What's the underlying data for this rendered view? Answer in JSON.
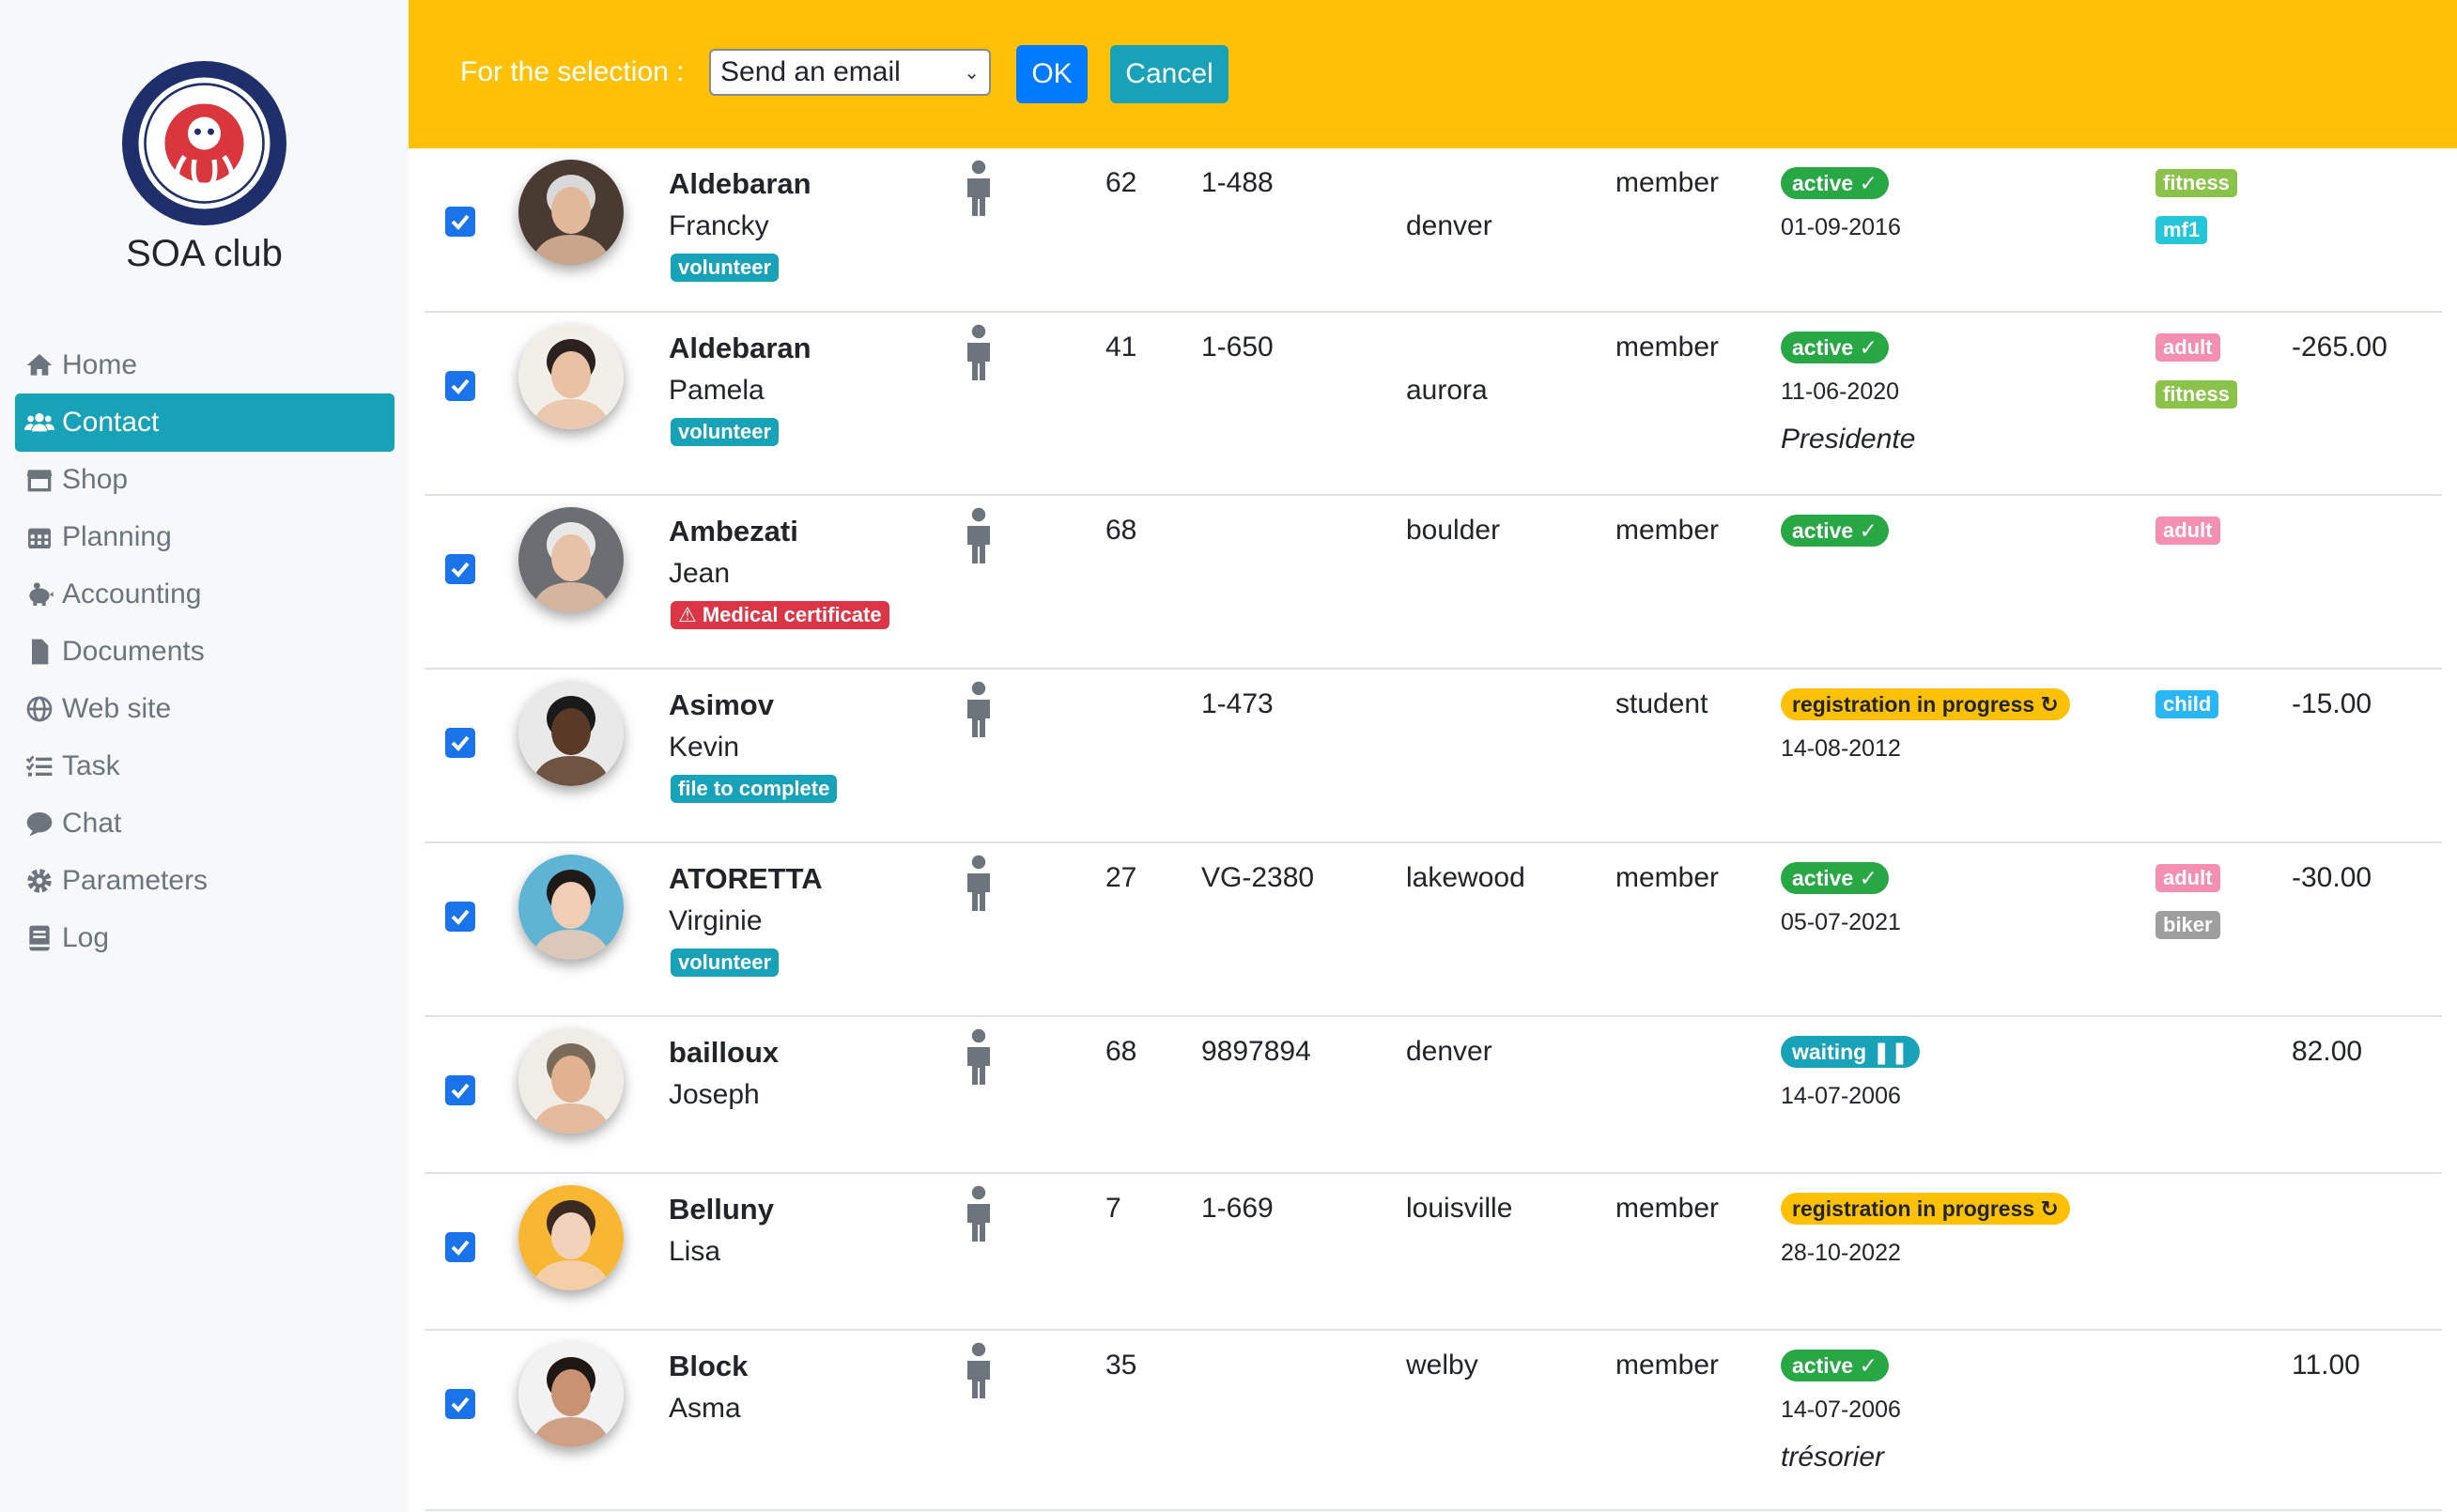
{
  "sidebar": {
    "club_name": "SOA club",
    "logo_icon": "dive-club-logo",
    "items": [
      {
        "label": "Home",
        "icon": "home-icon",
        "active": false
      },
      {
        "label": "Contact",
        "icon": "users-icon",
        "active": true
      },
      {
        "label": "Shop",
        "icon": "shop-icon",
        "active": false
      },
      {
        "label": "Planning",
        "icon": "calendar-icon",
        "active": false
      },
      {
        "label": "Accounting",
        "icon": "piggy-bank-icon",
        "active": false
      },
      {
        "label": "Documents",
        "icon": "file-icon",
        "active": false
      },
      {
        "label": "Web site",
        "icon": "globe-icon",
        "active": false
      },
      {
        "label": "Task",
        "icon": "task-list-icon",
        "active": false
      },
      {
        "label": "Chat",
        "icon": "chat-icon",
        "active": false
      },
      {
        "label": "Parameters",
        "icon": "gear-icon",
        "active": false
      },
      {
        "label": "Log",
        "icon": "log-book-icon",
        "active": false
      }
    ]
  },
  "selection_bar": {
    "label": "For the selection :",
    "action_value": "Send an email",
    "ok_label": "OK",
    "cancel_label": "Cancel",
    "bar_color": "#ffc107"
  },
  "contacts": [
    {
      "lastname": "Aldebaran",
      "firstname": "Francky",
      "badge": "volunteer",
      "badge_type": "info",
      "age": "62",
      "number": "1-488",
      "city": "denver",
      "category": "member",
      "status": "active",
      "status_type": "active",
      "date": "01-09-2016",
      "role": "",
      "tags": [
        {
          "label": "fitness",
          "type": "fitness"
        },
        {
          "label": "mf1",
          "type": "mf1"
        }
      ],
      "amount": ""
    },
    {
      "lastname": "Aldebaran",
      "firstname": "Pamela",
      "badge": "volunteer",
      "badge_type": "info",
      "age": "41",
      "number": "1-650",
      "city": "aurora",
      "category": "member",
      "status": "active",
      "status_type": "active",
      "date": "11-06-2020",
      "role": "Presidente",
      "tags": [
        {
          "label": "adult",
          "type": "adult"
        },
        {
          "label": "fitness",
          "type": "fitness"
        }
      ],
      "amount": "-265.00"
    },
    {
      "lastname": "Ambezati",
      "firstname": "Jean",
      "badge": "Medical certificate",
      "badge_type": "danger",
      "age": "68",
      "number": "",
      "city": "boulder",
      "category": "member",
      "status": "active",
      "status_type": "active",
      "date": "",
      "role": "",
      "tags": [
        {
          "label": "adult",
          "type": "adult"
        }
      ],
      "amount": ""
    },
    {
      "lastname": "Asimov",
      "firstname": "Kevin",
      "badge": "file to complete",
      "badge_type": "info",
      "age": "",
      "number": "1-473",
      "city": "",
      "category": "student",
      "status": "registration in progress",
      "status_type": "progress",
      "date": "14-08-2012",
      "role": "",
      "tags": [
        {
          "label": "child",
          "type": "child"
        }
      ],
      "amount": "-15.00"
    },
    {
      "lastname": "ATORETTA",
      "firstname": "Virginie",
      "badge": "volunteer",
      "badge_type": "info",
      "age": "27",
      "number": "VG-2380",
      "city": "lakewood",
      "category": "member",
      "status": "active",
      "status_type": "active",
      "date": "05-07-2021",
      "role": "",
      "tags": [
        {
          "label": "adult",
          "type": "adult"
        },
        {
          "label": "biker",
          "type": "biker"
        }
      ],
      "amount": "-30.00"
    },
    {
      "lastname": "bailloux",
      "firstname": "Joseph",
      "badge": "",
      "badge_type": "",
      "age": "68",
      "number": "9897894",
      "city": "denver",
      "category": "",
      "status": "waiting",
      "status_type": "waiting",
      "date": "14-07-2006",
      "role": "",
      "tags": [],
      "amount": "82.00"
    },
    {
      "lastname": "Belluny",
      "firstname": "Lisa",
      "badge": "",
      "badge_type": "",
      "age": "7",
      "number": "1-669",
      "city": "louisville",
      "category": "member",
      "status": "registration in progress",
      "status_type": "progress",
      "date": "28-10-2022",
      "role": "",
      "tags": [],
      "amount": ""
    },
    {
      "lastname": "Block",
      "firstname": "Asma",
      "badge": "",
      "badge_type": "",
      "age": "35",
      "number": "",
      "city": "welby",
      "category": "member",
      "status": "active",
      "status_type": "active",
      "date": "14-07-2006",
      "role": "trésorier",
      "tags": [],
      "amount": "11.00"
    }
  ]
}
